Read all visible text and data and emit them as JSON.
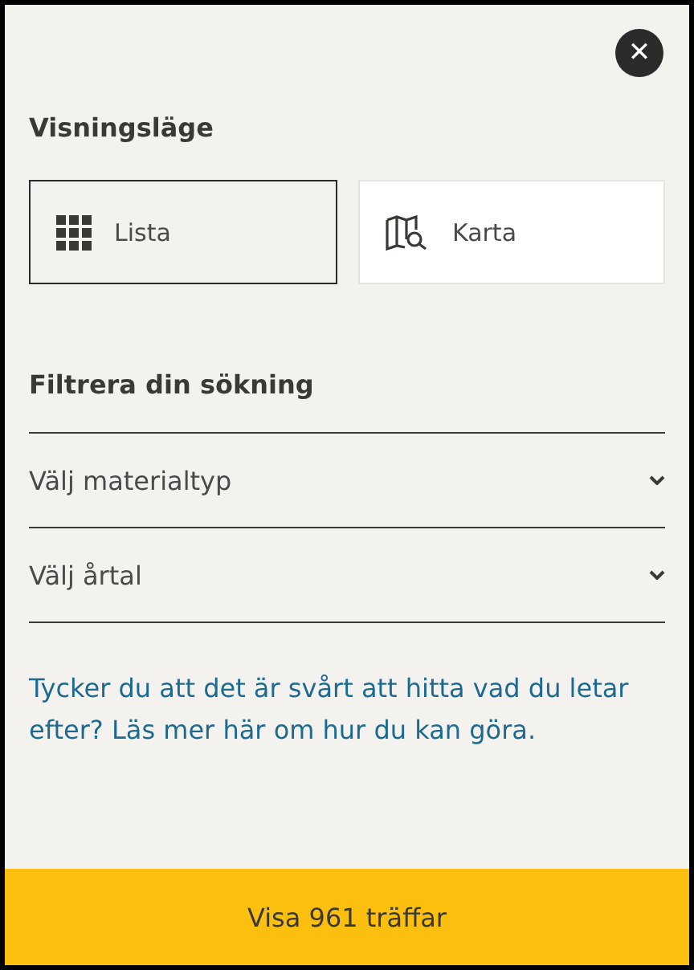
{
  "close_button": {
    "label": "✕"
  },
  "view_mode": {
    "heading": "Visningsläge",
    "options": [
      {
        "kind": "grid",
        "label": "Lista",
        "selected": true
      },
      {
        "kind": "map",
        "label": "Karta",
        "selected": false
      }
    ]
  },
  "filter": {
    "heading": "Filtrera din sökning",
    "dropdowns": [
      {
        "label": "Välj materialtyp",
        "expanded": false
      },
      {
        "label": "Välj årtal",
        "expanded": false
      }
    ]
  },
  "help_link": "Tycker du att det är svårt att hitta vad du letar efter? Läs mer här om hur du kan göra.",
  "submit_button": "Visa 961 träffar"
}
